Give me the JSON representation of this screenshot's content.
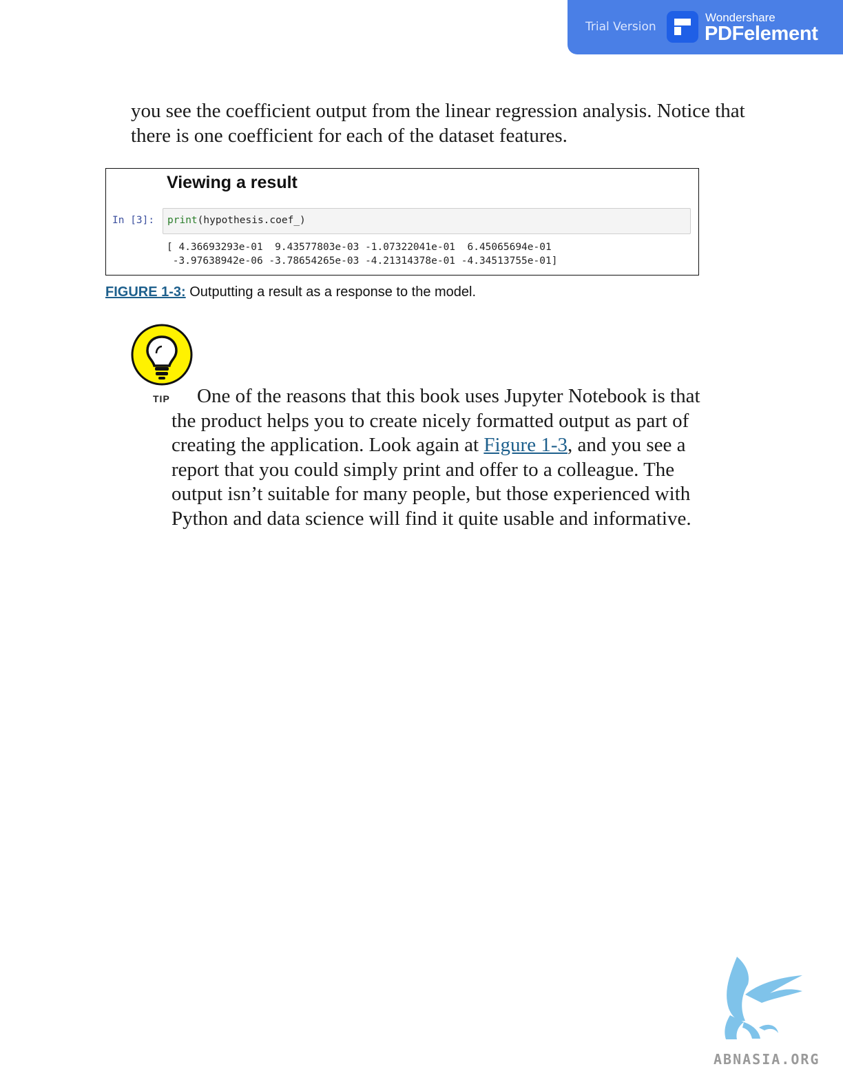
{
  "banner": {
    "trial_label": "Trial Version",
    "brand_small": "Wondershare",
    "brand_name": "PDFelement",
    "color": "#4a7fe6"
  },
  "intro_paragraph": "you see the coefficient output from the linear regression analysis. Notice that there is one coefficient for each of the dataset features.",
  "figure": {
    "title": "Viewing a result",
    "prompt": "In [3]:",
    "code_func": "print",
    "code_args": "(hypothesis.coef_)",
    "output_lines": [
      "[ 4.36693293e-01  9.43577803e-03 -1.07322041e-01  6.45065694e-01",
      " -3.97638942e-06 -3.78654265e-03 -4.21314378e-01 -4.34513755e-01]"
    ],
    "caption_label": "FIGURE 1-3:",
    "caption_text": " Outputting a result as a response to the model."
  },
  "tip": {
    "icon": "lightbulb-icon",
    "label": "TIP",
    "text_before_link": "One of the reasons that this book uses Jupyter Notebook is that the product helps you to create nicely formatted output as part of creating the application. Look again at ",
    "link_text": "Figure 1-3",
    "text_after_link": ", and you see a report that you could simply print and offer to a colleague. The output isn’t suitable for many people, but those experienced with Python and data science will find it quite usable and informative."
  },
  "watermark": {
    "text": "ABNASIA.ORG",
    "icon": "griffin-logo-icon"
  }
}
